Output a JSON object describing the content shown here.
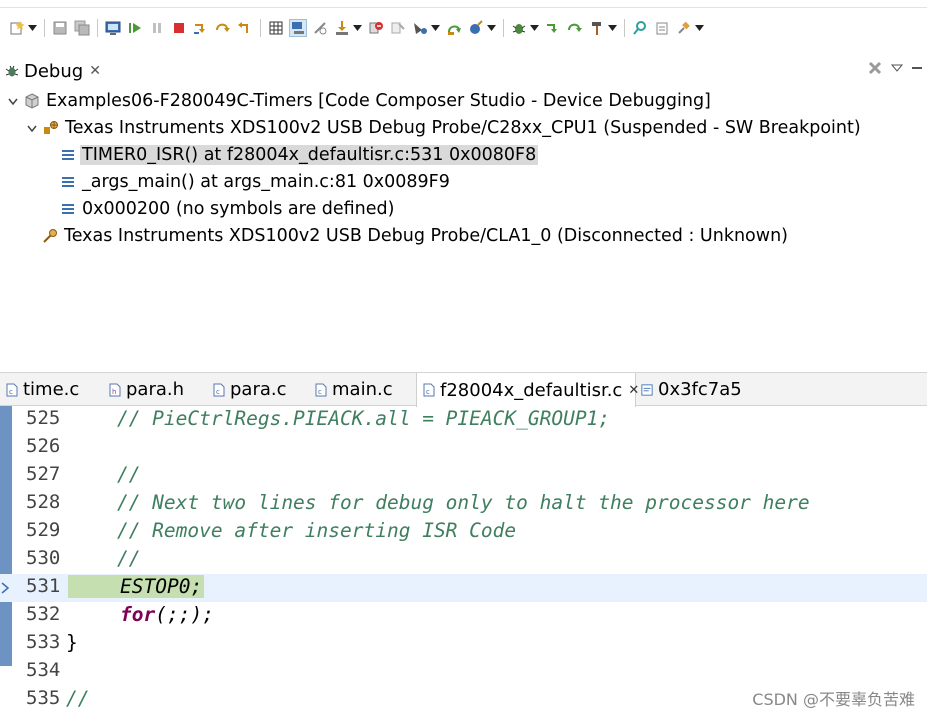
{
  "toolbar": {
    "icons": [
      "new-icon",
      "save-icon",
      "save-all-icon",
      "console-icon",
      "resume-icon",
      "suspend-icon",
      "terminate-icon",
      "step-into-icon",
      "step-over-icon",
      "step-return-icon",
      "registers-icon",
      "connect-icon",
      "disconnect-icon",
      "load-program-icon",
      "reset-icon",
      "breakpoint-icon",
      "restart-icon",
      "build-icon",
      "debug-icon",
      "bug-icon",
      "assembly-step-into-icon",
      "assembly-step-over-icon",
      "hammer-icon",
      "search-icon",
      "clipboard-icon",
      "pin-icon"
    ]
  },
  "debug": {
    "tab_label": "Debug",
    "tab_close": "✕",
    "tree": {
      "project": "Examples06-F280049C-Timers [Code Composer Studio - Device Debugging]",
      "cpu_probe": "Texas Instruments XDS100v2 USB Debug Probe/C28xx_CPU1 (Suspended - SW Breakpoint)",
      "frames": [
        "TIMER0_ISR() at f28004x_defaultisr.c:531 0x0080F8",
        "_args_main() at args_main.c:81 0x0089F9",
        "0x000200  (no symbols are defined)"
      ],
      "cla_probe": "Texas Instruments XDS100v2 USB Debug Probe/CLA1_0 (Disconnected : Unknown)"
    }
  },
  "editor": {
    "tabs": [
      {
        "label": "time.c"
      },
      {
        "label": "para.h"
      },
      {
        "label": "para.c"
      },
      {
        "label": "main.c"
      },
      {
        "label": "f28004x_defaultisr.c",
        "close": "✕"
      },
      {
        "label": "0x3fc7a5"
      }
    ],
    "lines": [
      {
        "num": "525",
        "text": "    // PieCtrlRegs.PIEACK.all = PIEACK_GROUP1;"
      },
      {
        "num": "526",
        "text": ""
      },
      {
        "num": "527",
        "text": "    //"
      },
      {
        "num": "528",
        "text": "    // Next two lines for debug only to halt the processor here"
      },
      {
        "num": "529",
        "text": "    // Remove after inserting ISR Code"
      },
      {
        "num": "530",
        "text": "    //"
      },
      {
        "num": "531",
        "text": "ESTOP0;"
      },
      {
        "num": "532",
        "kw": "for",
        "rest": "(;;);"
      },
      {
        "num": "533",
        "text": "}"
      },
      {
        "num": "534",
        "text": ""
      },
      {
        "num": "535",
        "text": "//"
      }
    ]
  },
  "watermark": "CSDN @不要辜负苦难",
  "colors": {
    "comment": "#3f7f5f",
    "keyword": "#7f0055",
    "current_line": "#e8f2fe",
    "current_highlight": "#c6dfb0",
    "gutter_strip": "#6d93c3",
    "selection": "#d9d9d9"
  }
}
